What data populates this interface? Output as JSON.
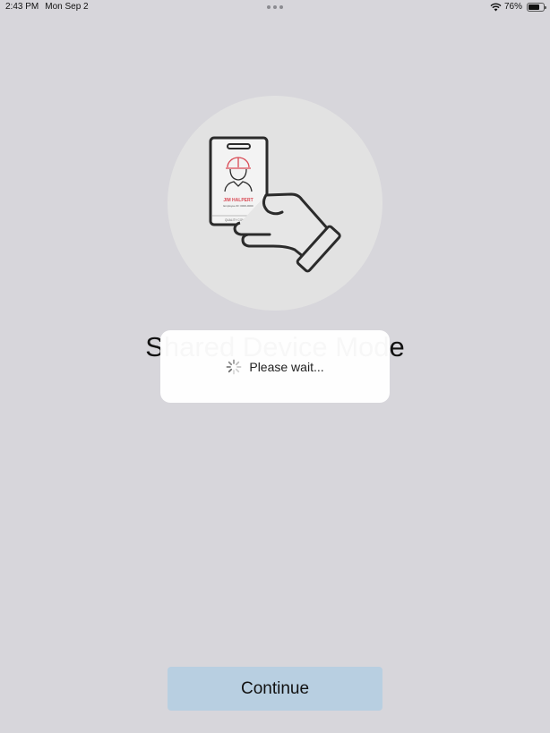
{
  "status_bar": {
    "time": "2:43 PM",
    "date": "Mon Sep 2",
    "battery_percent": "76%",
    "battery_level": 0.76,
    "icons": [
      "wifi-icon",
      "battery-icon"
    ]
  },
  "illustration": {
    "badge_name": "JIM HALPERT",
    "badge_id": "Employee ID: 0000-0000",
    "badge_dept": "QUALITY CONTROL",
    "accent_color": "#d94a55"
  },
  "main": {
    "title": "Shared Device Mode"
  },
  "loading_dialog": {
    "message": "Please wait..."
  },
  "actions": {
    "continue_label": "Continue"
  }
}
